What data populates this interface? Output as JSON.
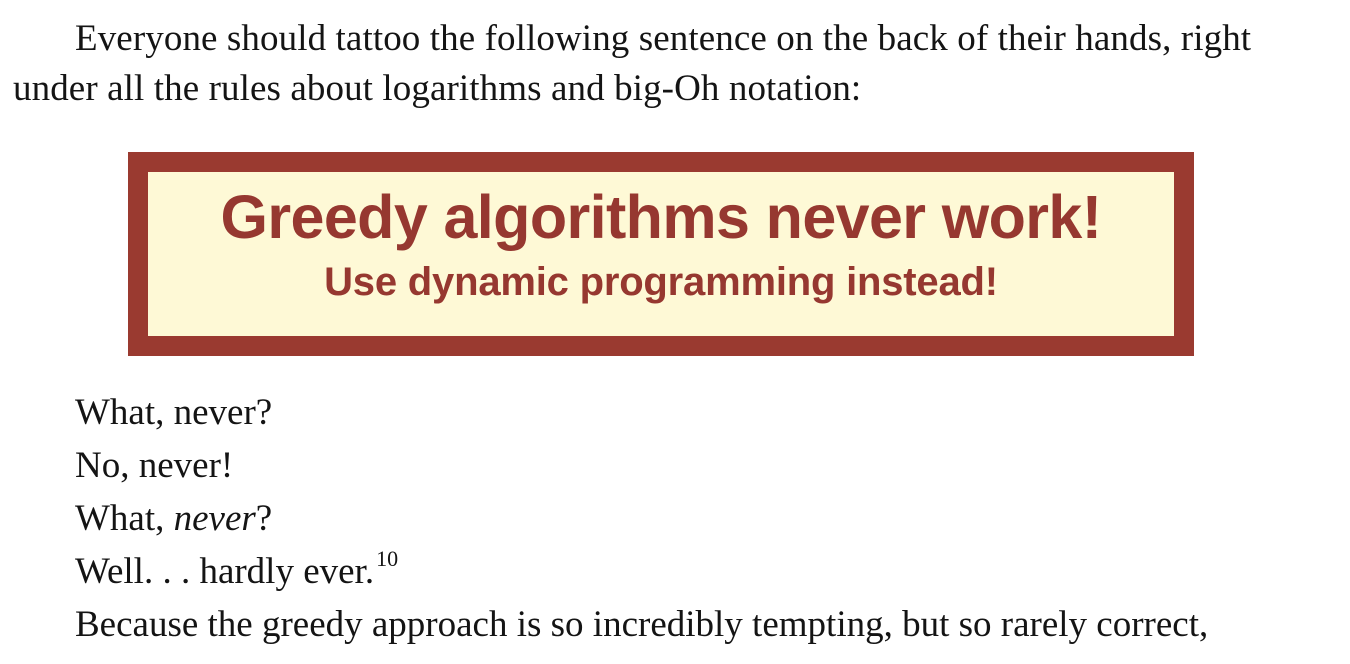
{
  "intro": {
    "text": "Everyone should tattoo the following sentence on the back of their hands, right under all the rules about logarithms and big-Oh notation:"
  },
  "callout": {
    "title": "Greedy algorithms never work!",
    "subtitle": "Use dynamic programming instead!",
    "border_color": "#9a3a30",
    "fill_color": "#fef9d6",
    "text_color": "#963830"
  },
  "poem": {
    "line1": "What, never?",
    "line2": "No, never!",
    "line3_prefix": "What, ",
    "line3_emphasis": "never",
    "line3_suffix": "?",
    "line4": "Well. . . hardly ever.",
    "line4_footnote": "10",
    "line5": "Because the greedy approach is so incredibly tempting, but so rarely correct,"
  }
}
